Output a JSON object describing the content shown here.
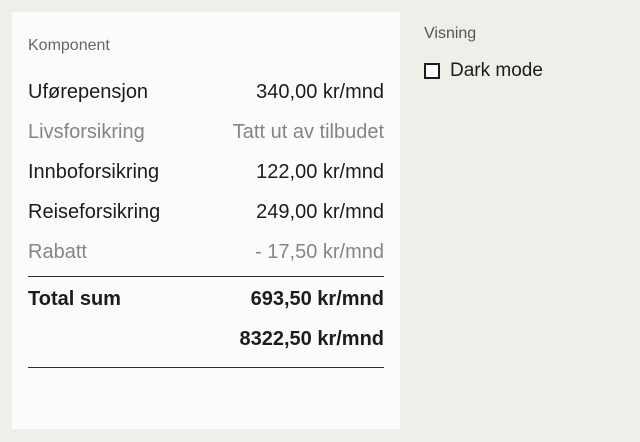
{
  "card": {
    "header": "Komponent",
    "rows": [
      {
        "label": "Uførepensjon",
        "value": "340,00 kr/mnd",
        "muted": false
      },
      {
        "label": "Livsforsikring",
        "value": "Tatt ut av tilbudet",
        "muted": true
      },
      {
        "label": "Innboforsikring",
        "value": "122,00 kr/mnd",
        "muted": false
      },
      {
        "label": "Reiseforsikring",
        "value": "249,00 kr/mnd",
        "muted": false
      },
      {
        "label": "Rabatt",
        "value": "- 17,50 kr/mnd",
        "muted": true
      }
    ],
    "total": {
      "label": "Total sum",
      "value": "693,50 kr/mnd",
      "value2": "8322,50 kr/mnd"
    }
  },
  "sidebar": {
    "title": "Visning",
    "dark_mode_label": "Dark mode",
    "dark_mode_checked": false
  }
}
